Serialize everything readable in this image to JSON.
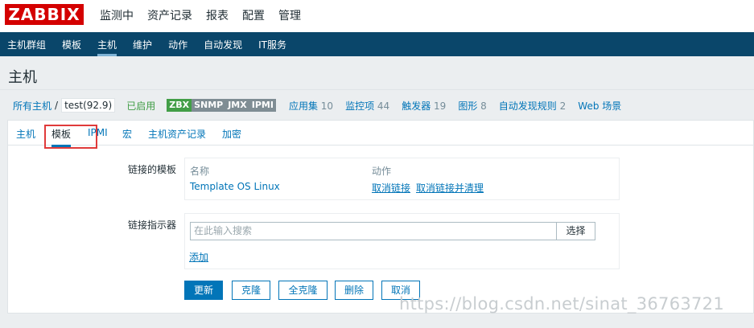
{
  "logo": "ZABBIX",
  "top_menu": [
    "监测中",
    "资产记录",
    "报表",
    "配置",
    "管理"
  ],
  "sub_menu": [
    "主机群组",
    "模板",
    "主机",
    "维护",
    "动作",
    "自动发现",
    "IT服务"
  ],
  "page_title": "主机",
  "host_nav": {
    "all_hosts": "所有主机",
    "separator": "/",
    "host_name": "test(92.9)",
    "status": "已启用",
    "badges": [
      "ZBX",
      "SNMP",
      "JMX",
      "IPMI"
    ],
    "items": [
      {
        "label": "应用集",
        "count": "10"
      },
      {
        "label": "监控项",
        "count": "44"
      },
      {
        "label": "触发器",
        "count": "19"
      },
      {
        "label": "图形",
        "count": "8"
      },
      {
        "label": "自动发现规则",
        "count": "2"
      },
      {
        "label": "Web 场景",
        "count": ""
      }
    ]
  },
  "tabs": [
    "主机",
    "模板",
    "IPMI",
    "宏",
    "主机资产记录",
    "加密"
  ],
  "linked_templates": {
    "label": "链接的模板",
    "col_name": "名称",
    "col_action": "动作",
    "template_name": "Template OS Linux",
    "unlink": "取消链接",
    "unlink_clear": "取消链接并清理"
  },
  "link_indicator": {
    "label": "链接指示器",
    "placeholder": "在此输入搜索",
    "select": "选择",
    "add": "添加"
  },
  "buttons": {
    "update": "更新",
    "clone": "克隆",
    "full_clone": "全克隆",
    "delete": "删除",
    "cancel": "取消"
  },
  "watermark": "https://blog.csdn.net/sinat_36763721",
  "colors": {
    "logo_red": "#d40000",
    "nav_dark": "#0a466a",
    "link_blue": "#0275b8",
    "enabled_green": "#429e47",
    "highlight_red": "#e03a3a"
  }
}
